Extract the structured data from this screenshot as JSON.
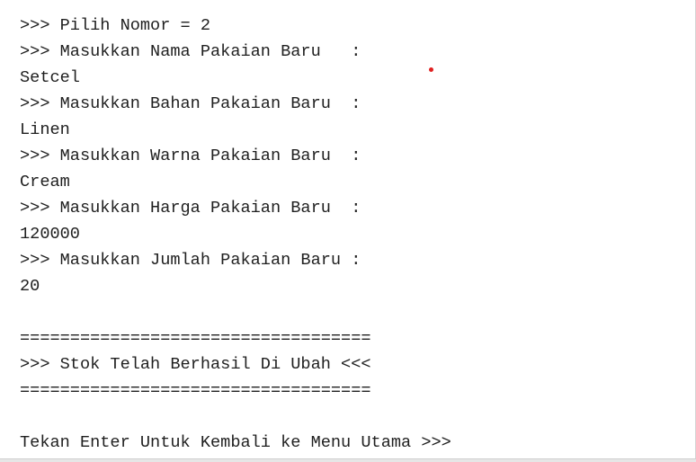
{
  "console": {
    "lines": [
      ">>> Pilih Nomor = 2",
      ">>> Masukkan Nama Pakaian Baru   :",
      "Setcel",
      ">>> Masukkan Bahan Pakaian Baru  :",
      "Linen",
      ">>> Masukkan Warna Pakaian Baru  :",
      "Cream",
      ">>> Masukkan Harga Pakaian Baru  :",
      "120000",
      ">>> Masukkan Jumlah Pakaian Baru :",
      "20",
      "",
      "===================================",
      ">>> Stok Telah Berhasil Di Ubah <<<",
      "===================================",
      "",
      "Tekan Enter Untuk Kembali ke Menu Utama >>>"
    ]
  },
  "colors": {
    "text": "#1f1f1f",
    "cursor_dot": "#e02020",
    "background": "#ffffff"
  }
}
